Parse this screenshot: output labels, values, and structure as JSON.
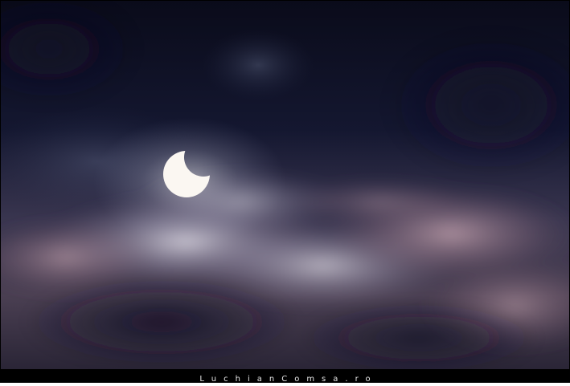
{
  "photo": {
    "subject": "partial-solar-eclipse",
    "colors": {
      "sky_dark": "#0c0d1d",
      "cloud_light": "#d8d2de",
      "cloud_pink": "#b89aa6",
      "sun": "#fbf7f2"
    }
  },
  "watermark": {
    "text": "LuchianComsa.ro"
  }
}
